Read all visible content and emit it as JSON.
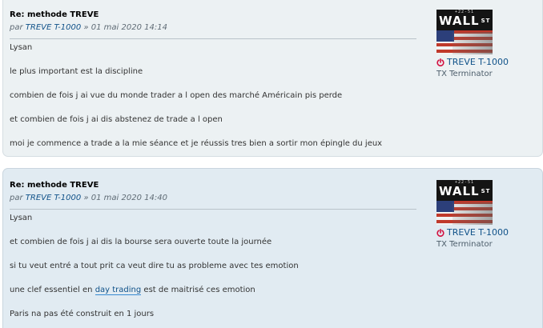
{
  "posts": [
    {
      "title": "Re: methode TREVE",
      "author_prefix": "par",
      "author": "TREVE T-1000",
      "date": "» 01 mai 2020 14:14",
      "content": [
        "Lysan",
        "le plus important est la discipline",
        "combien de fois j ai vue du monde trader a l open des marché Américain pis perde",
        "et combien de fois j ai dis abstenez de trade a l open",
        "moi je commence a trade a la mie séance et je réussis tres bien a sortir mon épingle du jeux"
      ],
      "profile": {
        "avatar_text": "WALL",
        "avatar_sup": "ST",
        "avatar_ticker": "+22-51",
        "username": "TREVE T-1000",
        "rank": "TX Terminator"
      }
    },
    {
      "title": "Re: methode TREVE",
      "author_prefix": "par",
      "author": "TREVE T-1000",
      "date": "» 01 mai 2020 14:40",
      "content": [
        "Lysan",
        "et combien de fois j ai dis la bourse sera ouverte toute la journée",
        "si tu veut entré a tout prit ca veut dire tu as probleme avec tes emotion",
        {
          "before": "une clef essentiel en",
          "link": "day trading",
          "after": "est de maitrisé ces emotion"
        },
        "Paris na pas été construit en 1 jours"
      ],
      "profile": {
        "avatar_text": "WALL",
        "avatar_sup": "ST",
        "avatar_ticker": "+22-51",
        "username": "TREVE T-1000",
        "rank": "TX Terminator"
      }
    }
  ],
  "icons": {
    "online_status": "power-icon",
    "online_color": "#d31141"
  }
}
